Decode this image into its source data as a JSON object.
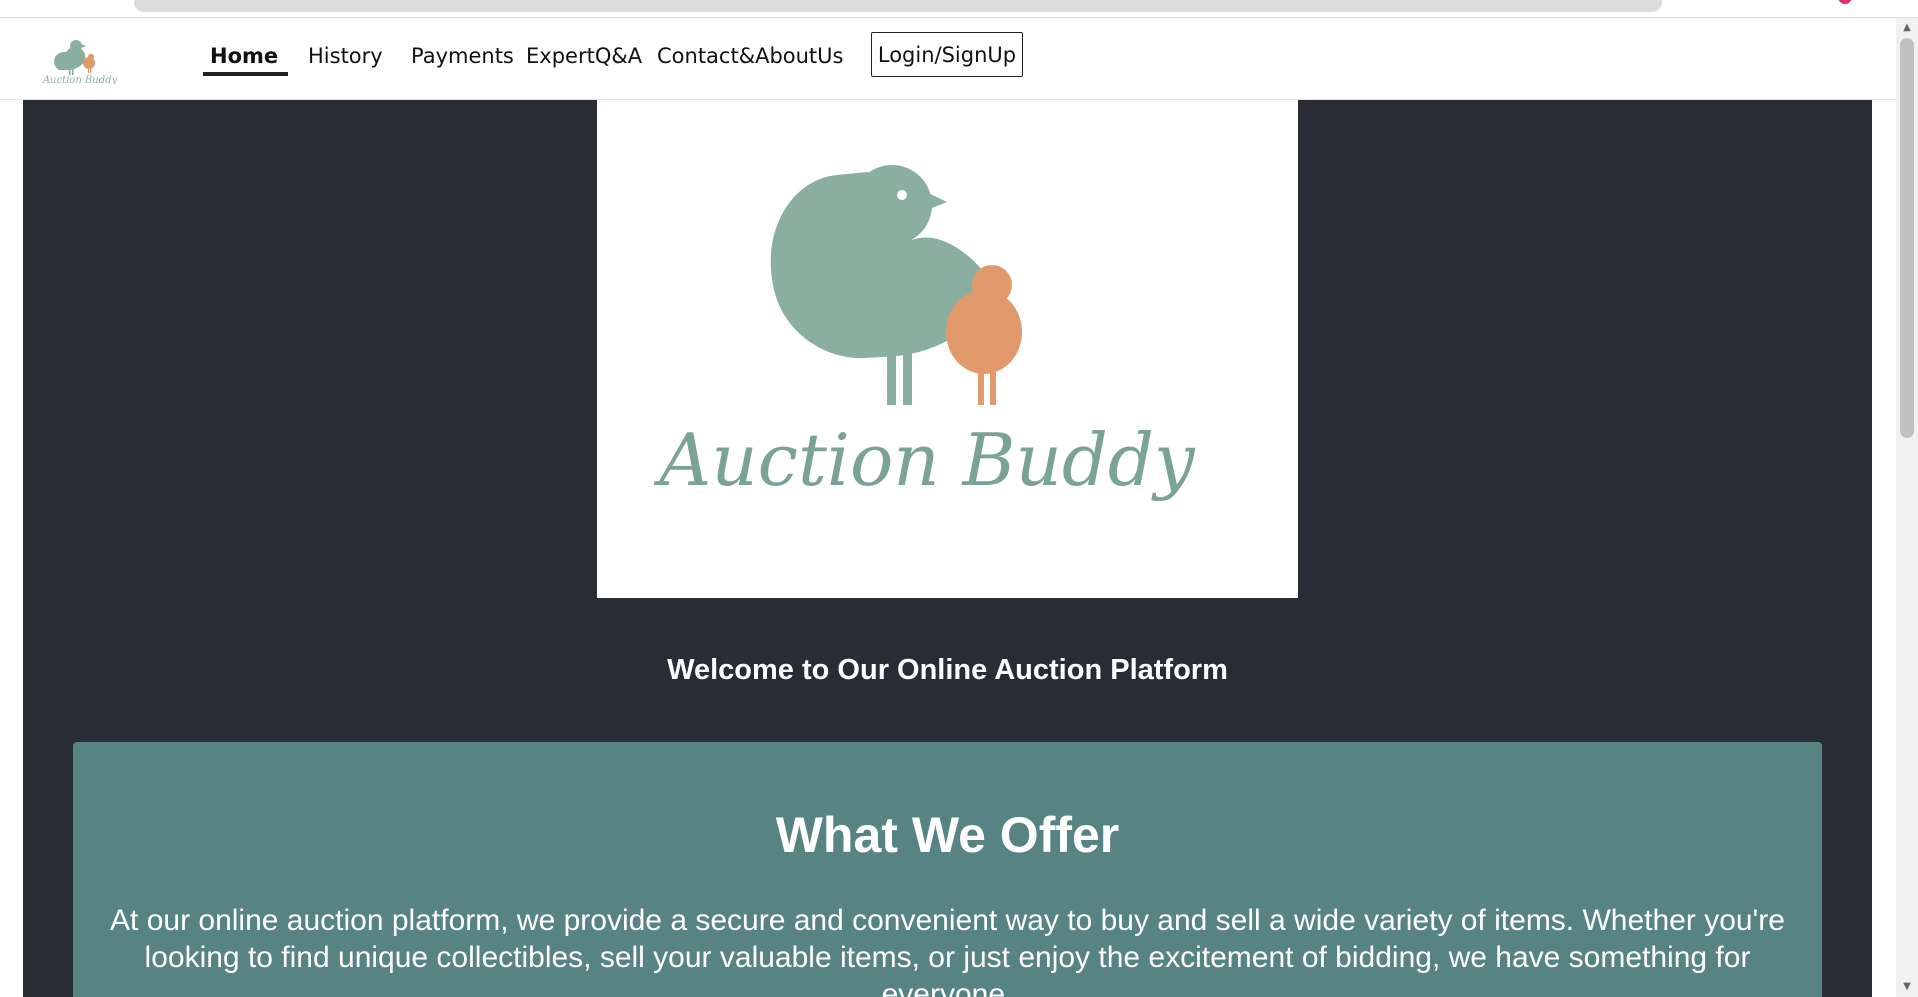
{
  "brand": {
    "name": "Auction Buddy",
    "colors": {
      "bird_large": "#8aafa1",
      "bird_small": "#e29a6d",
      "accent_dark": "#282c34",
      "offer_bg": "#588383"
    }
  },
  "nav": {
    "items": [
      {
        "label": "Home",
        "active": true
      },
      {
        "label": "History",
        "active": false
      },
      {
        "label": "Payments",
        "active": false
      },
      {
        "label": "ExpertQ&A",
        "active": false
      },
      {
        "label": "Contact&AboutUs",
        "active": false
      }
    ],
    "login_label": "Login/SignUp"
  },
  "hero": {
    "logo_text": "Auction Buddy"
  },
  "welcome": "Welcome to Our Online Auction Platform",
  "offer": {
    "title": "What We Offer",
    "text": "At our online auction platform, we provide a secure and convenient way to buy and sell a wide variety of items. Whether you're looking to find unique collectibles, sell your valuable items, or just enjoy the excitement of bidding, we have something for everyone."
  }
}
